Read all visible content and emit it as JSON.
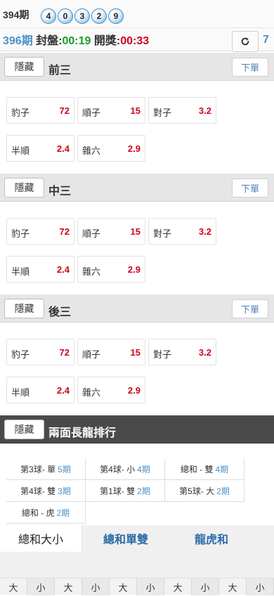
{
  "draw": {
    "period": "394期",
    "balls": [
      "4",
      "0",
      "3",
      "2",
      "9"
    ]
  },
  "status": {
    "period": "396期",
    "close_label": " 封盤:",
    "close_time": "00:19",
    "open_label": " 開獎:",
    "open_time": "00:33",
    "refresh_count": "7"
  },
  "sections": [
    {
      "hide_label": "隱藏",
      "title": "前三",
      "order_label": "下單",
      "odds": [
        {
          "name": "豹子",
          "value": "72"
        },
        {
          "name": "順子",
          "value": "15"
        },
        {
          "name": "對子",
          "value": "3.2"
        },
        {
          "name": "半順",
          "value": "2.4"
        },
        {
          "name": "雜六",
          "value": "2.9"
        }
      ]
    },
    {
      "hide_label": "隱藏",
      "title": "中三",
      "order_label": "下單",
      "odds": [
        {
          "name": "豹子",
          "value": "72"
        },
        {
          "name": "順子",
          "value": "15"
        },
        {
          "name": "對子",
          "value": "3.2"
        },
        {
          "name": "半順",
          "value": "2.4"
        },
        {
          "name": "雜六",
          "value": "2.9"
        }
      ]
    },
    {
      "hide_label": "隱藏",
      "title": "後三",
      "order_label": "下單",
      "odds": [
        {
          "name": "豹子",
          "value": "72"
        },
        {
          "name": "順子",
          "value": "15"
        },
        {
          "name": "對子",
          "value": "3.2"
        },
        {
          "name": "半順",
          "value": "2.4"
        },
        {
          "name": "雜六",
          "value": "2.9"
        }
      ]
    }
  ],
  "long_dragon": {
    "hide_label": "隱藏",
    "title": "兩面長龍排行",
    "items": [
      {
        "label": "第3球- 單",
        "num": "5期"
      },
      {
        "label": "第4球- 小",
        "num": "4期"
      },
      {
        "label": "總和  - 雙",
        "num": "4期"
      },
      {
        "label": "第4球- 雙",
        "num": "3期"
      },
      {
        "label": "第1球- 雙",
        "num": "2期"
      },
      {
        "label": "第5球- 大",
        "num": "2期"
      },
      {
        "label": "總和  - 虎",
        "num": "2期"
      }
    ]
  },
  "tabs": [
    "總和大小",
    "總和單雙",
    "龍虎和"
  ],
  "beads": [
    "大",
    "小",
    "大",
    "小",
    "大",
    "小",
    "大",
    "小",
    "大",
    "小"
  ],
  "colors": {
    "accent_blue": "#4a90c8",
    "odds_red": "#d0021b",
    "green": "#1a9a2a"
  }
}
